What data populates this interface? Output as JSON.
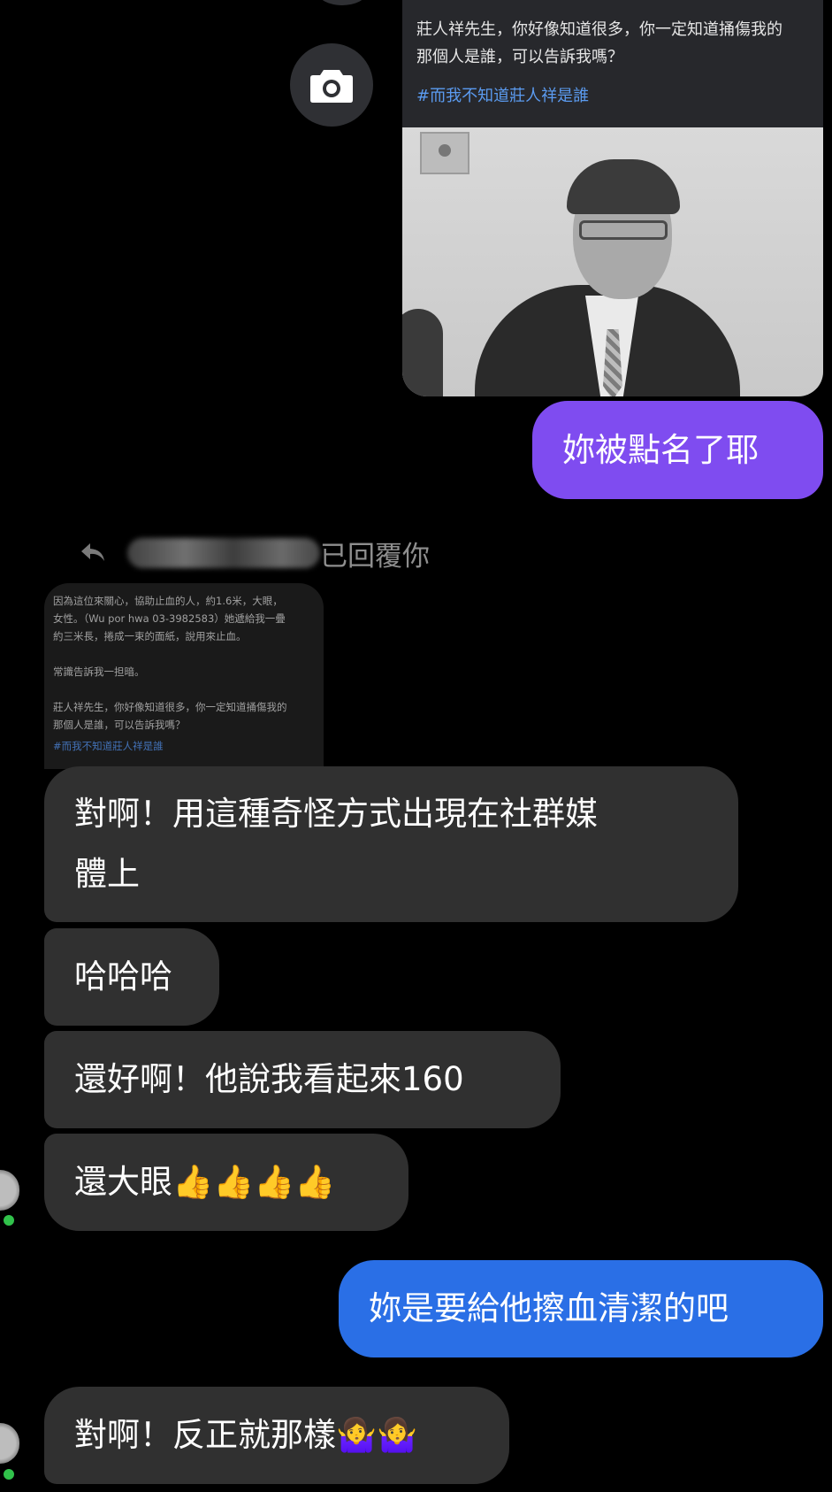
{
  "shared_post": {
    "text": "莊人祥先生，你好像知道很多，你一定知道捅傷我的\n那個人是誰，可以告訴我嗎？",
    "hashtag": "#而我不知道莊人祥是誰"
  },
  "messages": {
    "sent_1": "妳被點名了耶",
    "reply_label": "已回覆你",
    "quoted_text": "因為這位來關心，協助止血的人，約1.6米，大眼，\n女性。（Wu por hwa 03-3982583）她遞給我一疊\n約三米長，捲成一束的面紙，說用來止血。\n\n常識告訴我一担暗。\n\n莊人祥先生，你好像知道很多，你一定知道捅傷我的\n那個人是誰，可以告訴我嗎？",
    "quoted_tag": "#而我不知道莊人祥是誰",
    "recv_1_line1": "對啊！用這種奇怪方式出現在社群媒",
    "recv_1_line2": "體上",
    "recv_2": "哈哈哈",
    "recv_3": "還好啊！他說我看起來160",
    "recv_4": "還大眼👍👍👍👍",
    "sent_2": "妳是要給他擦血清潔的吧",
    "recv_5": "對啊！反正就那樣🤷‍♀️🤷‍♀️"
  },
  "colors": {
    "background": "#000000",
    "incoming_bubble": "#303030",
    "outgoing_purple": "#7f4cf0",
    "outgoing_blue": "#2a6fe6",
    "hashtag": "#5b9bf0",
    "online": "#31c24b"
  },
  "icons": [
    "camera-icon",
    "reply-arrow-icon"
  ]
}
